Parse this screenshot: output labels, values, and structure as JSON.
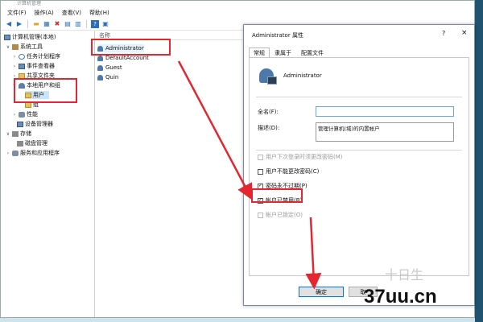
{
  "window": {
    "title": "计算机管理"
  },
  "menu": [
    "文件(F)",
    "操作(A)",
    "查看(V)",
    "帮助(H)"
  ],
  "toolbar_icons": [
    "back-icon",
    "forward-icon",
    "up-folder-icon",
    "show-hide-tree-icon",
    "delete-icon",
    "properties-icon",
    "export-icon",
    "help-icon",
    "view-icon"
  ],
  "tree": {
    "root": "计算机管理(本地)",
    "system_tools": "系统工具",
    "task_scheduler": "任务计划程序",
    "event_viewer": "事件查看器",
    "shared_folders": "共享文件夹",
    "local_users_groups": "本地用户和组",
    "users": "用户",
    "groups": "组",
    "performance": "性能",
    "device_manager": "设备管理器",
    "storage": "存储",
    "disk_management": "磁盘管理",
    "services_apps": "服务和应用程序"
  },
  "list": {
    "header": "名称",
    "items": [
      "Administrator",
      "DefaultAccount",
      "Guest",
      "Quin"
    ]
  },
  "dialog": {
    "title": "Administrator 属性",
    "help": "?",
    "close": "×",
    "tabs": [
      "常规",
      "隶属于",
      "配置文件"
    ],
    "account_name": "Administrator",
    "fullname_label": "全名(F):",
    "fullname_value": "",
    "desc_label": "描述(D):",
    "desc_value": "管理计算机(域)的内置帐户",
    "checkboxes": [
      {
        "label": "用户下次登录时须更改密码(M)",
        "checked": false,
        "enabled": false
      },
      {
        "label": "用户不能更改密码(C)",
        "checked": false,
        "enabled": true
      },
      {
        "label": "密码永不过期(P)",
        "checked": true,
        "enabled": true
      },
      {
        "label": "帐户已禁用(B)",
        "checked": true,
        "enabled": true
      },
      {
        "label": "帐户已锁定(O)",
        "checked": false,
        "enabled": false
      }
    ],
    "ok": "确定",
    "cancel": "取"
  },
  "colors": {
    "annotation": "#e3262f",
    "accent": "#0078d7"
  },
  "watermark": {
    "text": "37uu.cn",
    "faint": "十日生"
  }
}
